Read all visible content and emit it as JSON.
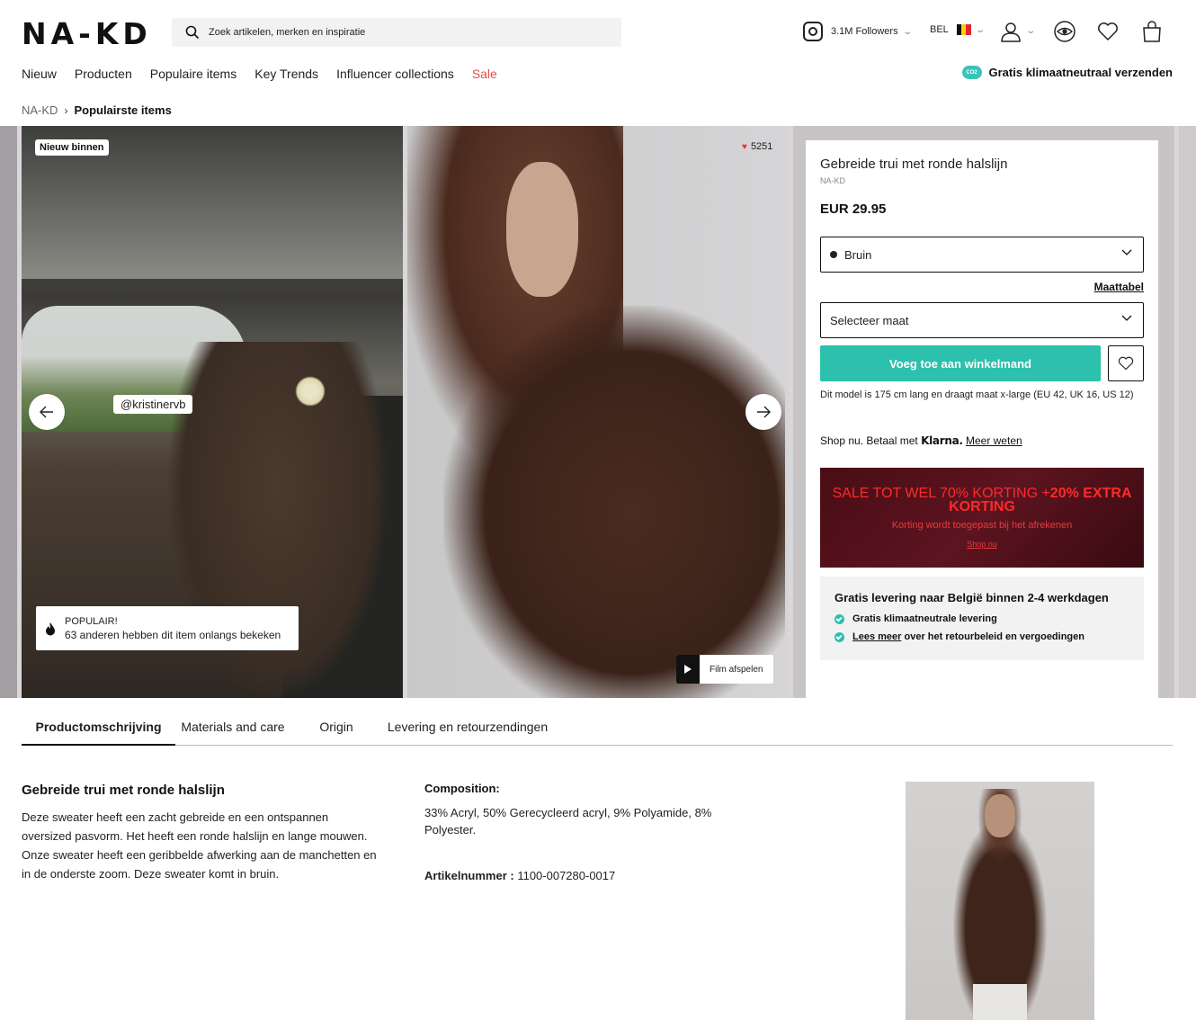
{
  "header": {
    "logo": "NA-KD",
    "search_placeholder": "Zoek artikelen, merken en inspiratie",
    "instagram_followers": "3.1M Followers",
    "region": "BEL"
  },
  "nav": {
    "items": [
      "Nieuw",
      "Producten",
      "Populaire items",
      "Key Trends",
      "Influencer collections",
      "Sale"
    ],
    "climate_text": "Gratis klimaatneutraal verzenden",
    "climate_badge": "CO2"
  },
  "breadcrumb": {
    "root": "NA-KD",
    "current": "Populairste items"
  },
  "gallery": {
    "new_badge": "Nieuw binnen",
    "influencer_handle": "@kristinervb",
    "popular_title": "POPULAIR!",
    "popular_text": "63 anderen hebben dit item onlangs bekeken",
    "likes": "5251",
    "film_label": "Film afspelen"
  },
  "product": {
    "title": "Gebreide trui met ronde halslijn",
    "brand": "NA-KD",
    "price": "EUR 29.95",
    "color_selected": "Bruin",
    "size_chart": "Maattabel",
    "size_placeholder": "Selecteer maat",
    "add_to_cart": "Voeg toe aan winkelmand",
    "model_note": "Dit model is 175 cm lang en draagt maat x-large (EU 42, UK 16, US 12)",
    "klarna_prefix": "Shop nu. Betaal met",
    "klarna_brand": "Klarna.",
    "klarna_link": "Meer weten"
  },
  "promo": {
    "headline_1": "SALE TOT WEL 70% KORTING +",
    "headline_2": "20% EXTRA KORTING",
    "sub": "Korting wordt toegepast bij het afrekenen",
    "link": "Shop nu"
  },
  "delivery": {
    "title": "Gratis levering naar België binnen 2-4 werkdagen",
    "item_1": "Gratis klimaatneutrale levering",
    "item_2_link": "Lees meer",
    "item_2_text": "over het retourbeleid en vergoedingen"
  },
  "tabs": [
    "Productomschrijving",
    "Materials and care",
    "Origin",
    "Levering en retourzendingen"
  ],
  "description": {
    "title": "Gebreide trui met ronde halslijn",
    "body": "Deze sweater heeft een zacht gebreide en een ontspannen oversized pasvorm. Het heeft een ronde halslijn en lange mouwen. Onze sweater heeft een geribbelde afwerking aan de manchetten en in de onderste zoom. Deze sweater komt in bruin.",
    "composition_label": "Composition:",
    "composition": "33% Acryl, 50% Gerecycleerd acryl, 9% Polyamide, 8% Polyester.",
    "article_label": "Artikelnummer :",
    "article_number": "1100-007280-0017"
  },
  "colors": {
    "accent": "#2cc0ad",
    "sale": "#e0514a",
    "promo_bg": "#4a0d15"
  }
}
